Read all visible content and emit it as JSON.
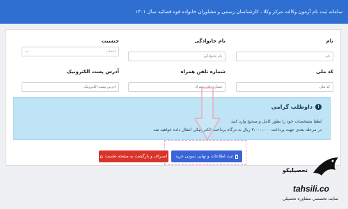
{
  "header": {
    "title": "سامانه ثبت نام آزمون وکالت مرکز وکلا ، کارشناسان رسمی و مشاوران خانواده قوه قضائیه سال ۱۴۰۱"
  },
  "form": {
    "name": {
      "label": "نام",
      "placeholder": "نام"
    },
    "family": {
      "label": "نام خانوادگی",
      "placeholder": "نام خانوادگی"
    },
    "gender": {
      "label": "جنسیت",
      "selected": "انتخاب"
    },
    "national_code": {
      "label": "کد ملی",
      "placeholder": "کد ملی"
    },
    "mobile": {
      "label": "شماره تلفن همراه",
      "placeholder": "شماره تلفن همراه"
    },
    "email": {
      "label": "آدرس پست الکترونیک",
      "placeholder": "آدرس پست الکترونیک"
    }
  },
  "alert": {
    "title": "داوطلب گرامی",
    "line1": "لطفا مشخصات خود را بطور کامل و صحیح وارد کنید",
    "line2": "در مرحله بعدی جهت پرداخت ۳،۰۰۰،۰۰۰ ریال به درگاه پرداخت الکترونیکی انتقال داده خواهید شد"
  },
  "buttons": {
    "submit": "ثبت اطلاعات و نهایی نمودن خرید",
    "back": "انصراف و بازگشت به صفحه نخست"
  },
  "watermark": {
    "brand_fa": "تحصیلیکو",
    "domain": "tahsili.co",
    "tagline": "سایت تخصصی مشاوره تحصیلی"
  },
  "colors": {
    "header": "#2f6fd1",
    "alert_bg": "#bfe4f6",
    "submit": "#3a64d8",
    "back": "#d9342b",
    "annotation": "#f3a4b8"
  }
}
